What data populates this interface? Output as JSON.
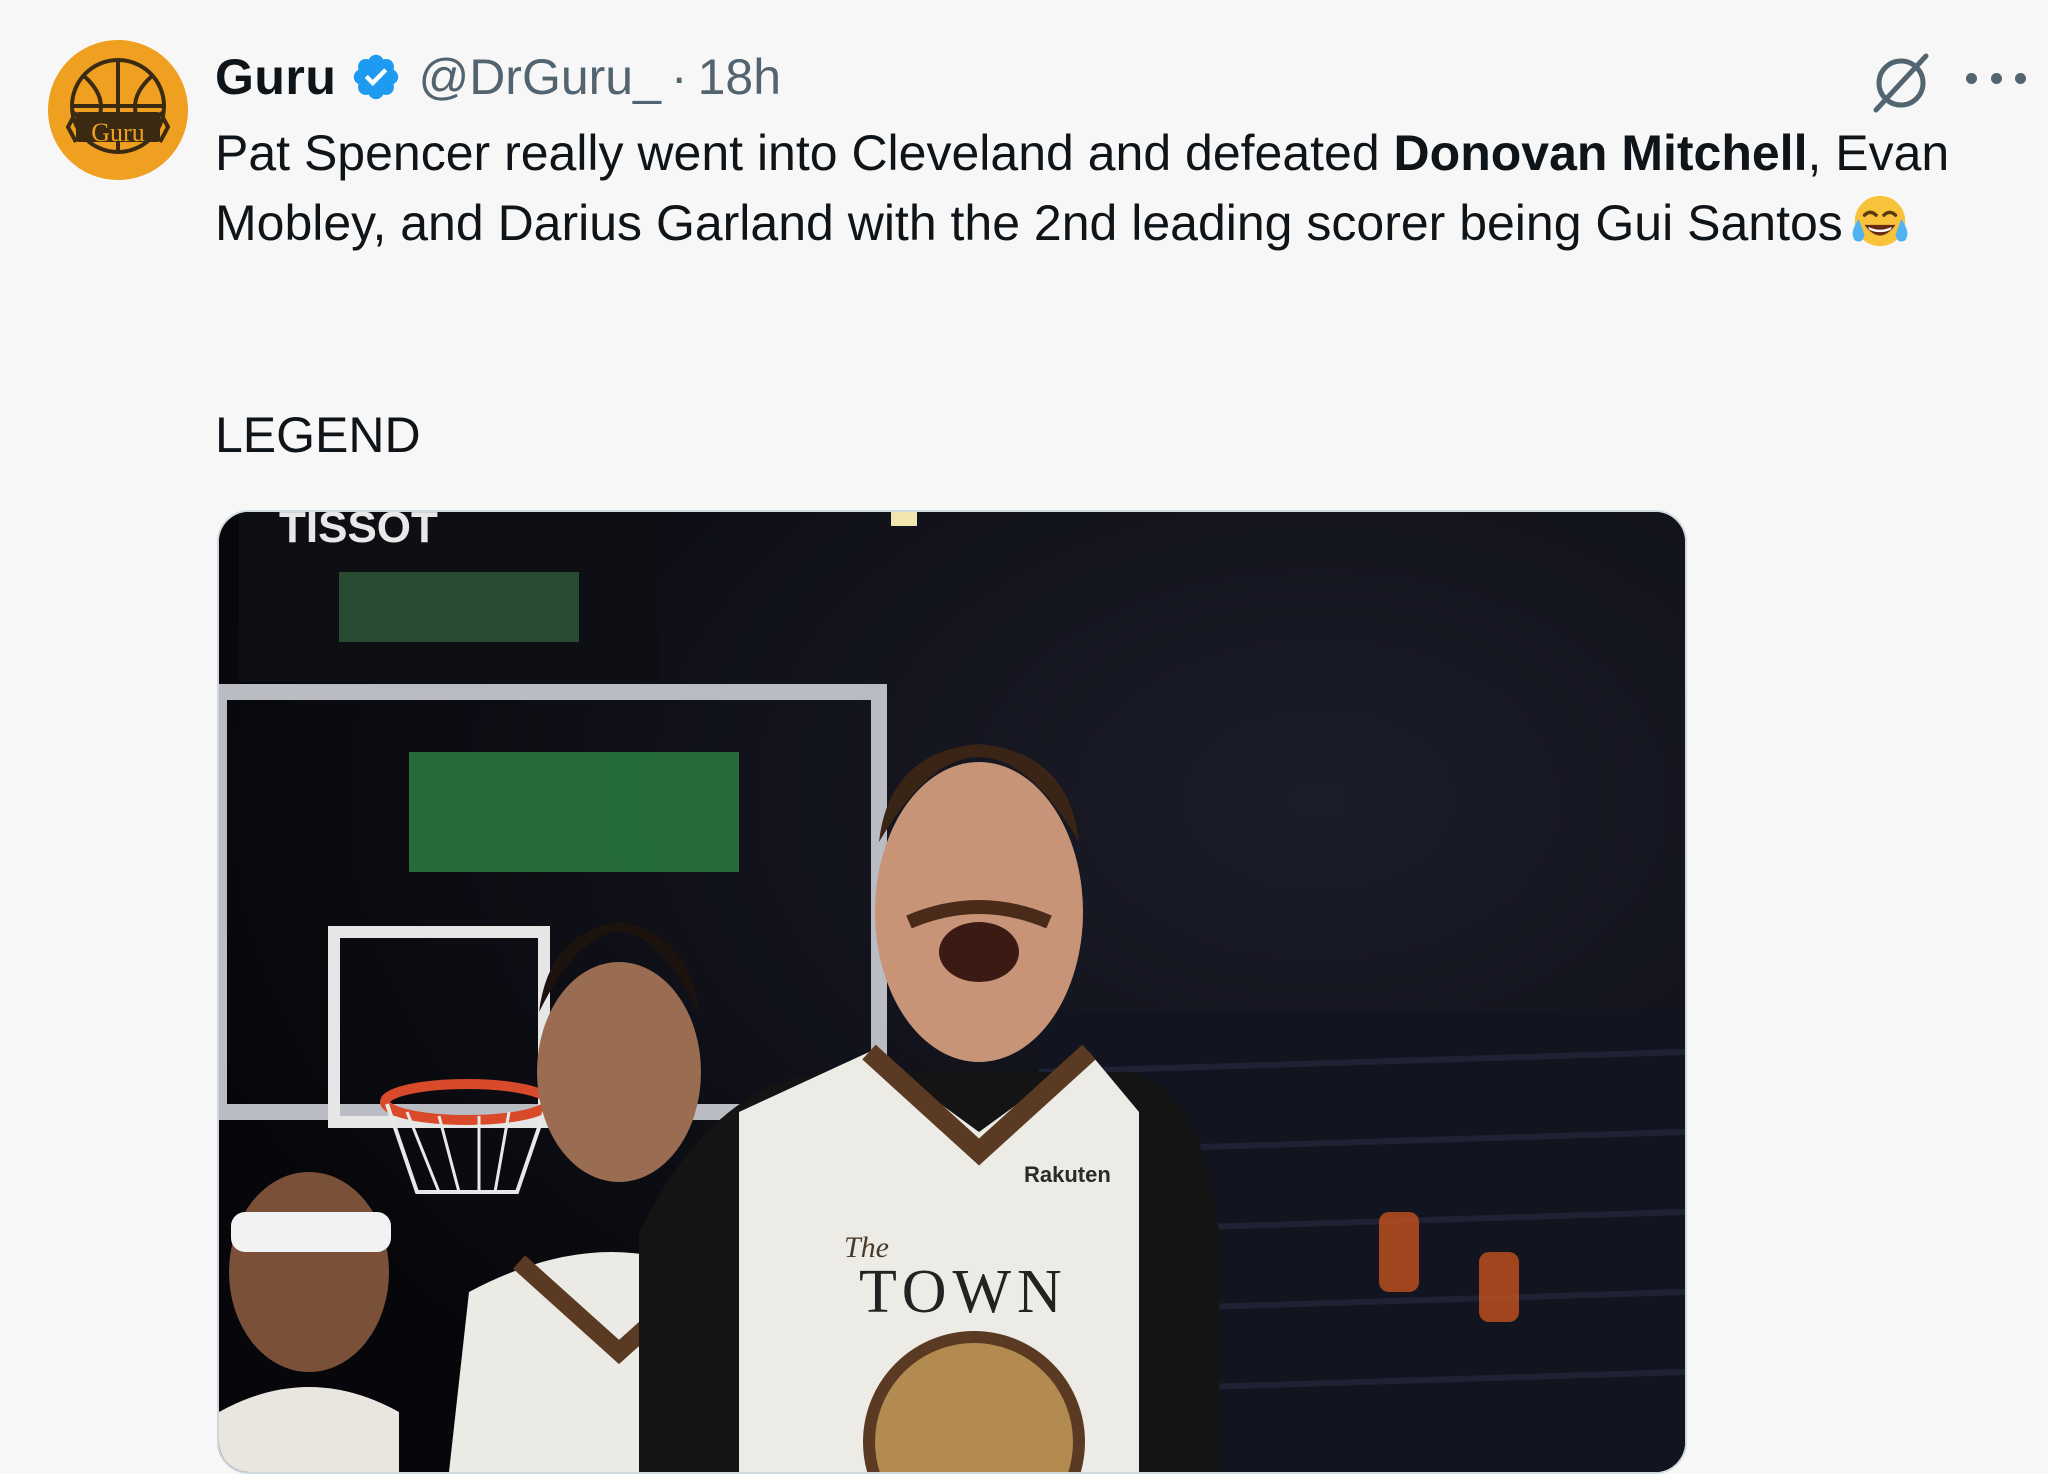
{
  "tweet": {
    "author": {
      "name": "Guru",
      "handle": "@DrGuru_",
      "time": "18h",
      "separator": "·",
      "avatar_text": "Guru",
      "verified_color": "#1d9bf0"
    },
    "text": {
      "part1": "Pat Spencer really went into Cleveland and defeated ",
      "bold": "Donovan Mitchell",
      "part2": ", Evan Mobley, and Darius Garland with the 2nd leading scorer being Gui Santos",
      "emoji": "face-with-tears-of-joy"
    },
    "legend": "LEGEND",
    "media": {
      "scoreboard_brand": "TISSOT",
      "jersey_sponsor": "Rakuten",
      "jersey_script": "The",
      "jersey_word": "TOWN"
    }
  },
  "colors": {
    "background": "#f7f7f7",
    "text": "#0f1419",
    "secondary": "#536471",
    "avatar": "#f0a020"
  }
}
